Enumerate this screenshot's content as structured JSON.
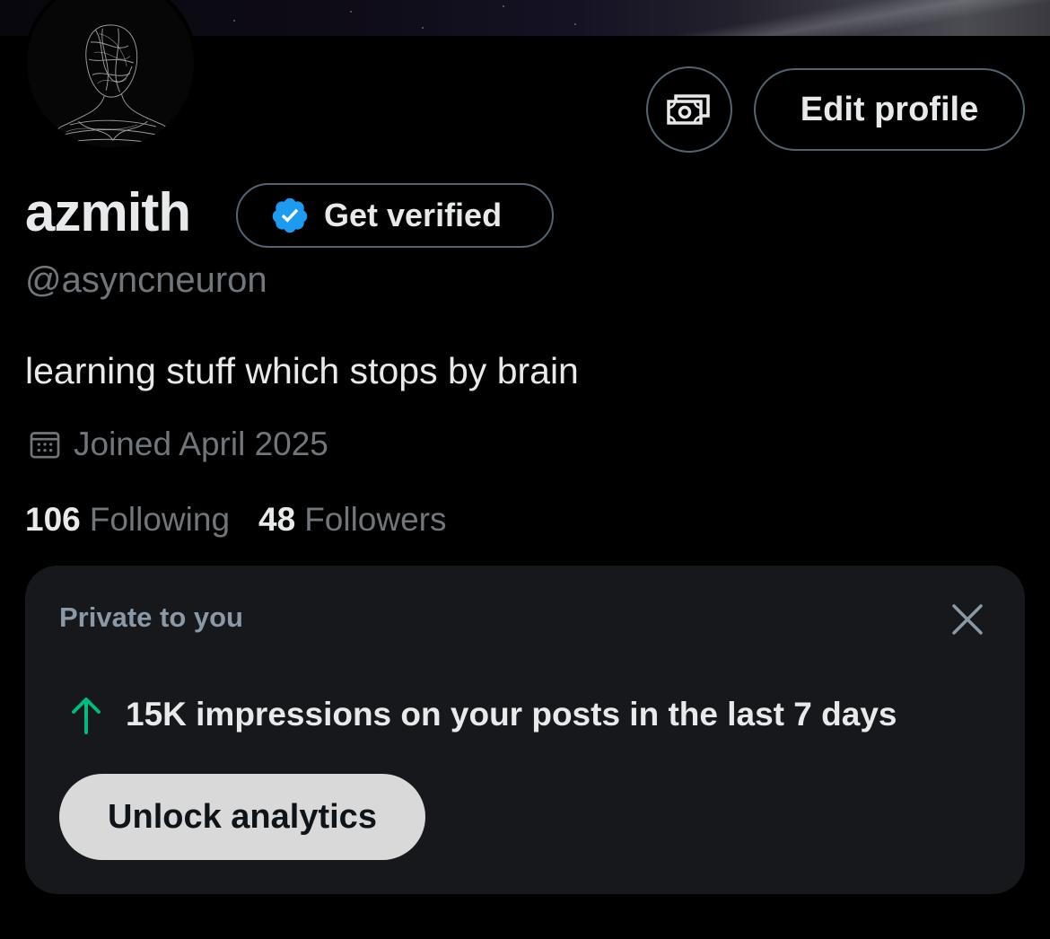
{
  "profile": {
    "display_name": "azmith",
    "handle": "@asyncneuron",
    "bio": "learning stuff which stops by brain",
    "joined": "Joined April 2025",
    "following_count": "106",
    "following_label": "Following",
    "followers_count": "48",
    "followers_label": "Followers"
  },
  "actions": {
    "edit_profile": "Edit profile",
    "money_icon": "money-icon",
    "get_verified": "Get verified"
  },
  "private_card": {
    "title": "Private to you",
    "metric": "15K impressions on your posts in the last 7 days",
    "button": "Unlock analytics",
    "close_icon": "close-icon",
    "arrow_icon": "arrow-up-icon"
  },
  "colors": {
    "background": "#000000",
    "text": "#e7e9ea",
    "muted": "#71767b",
    "verified_blue": "#1d9bf0",
    "growth_green": "#00ba7c",
    "card_bg": "#16181c"
  }
}
